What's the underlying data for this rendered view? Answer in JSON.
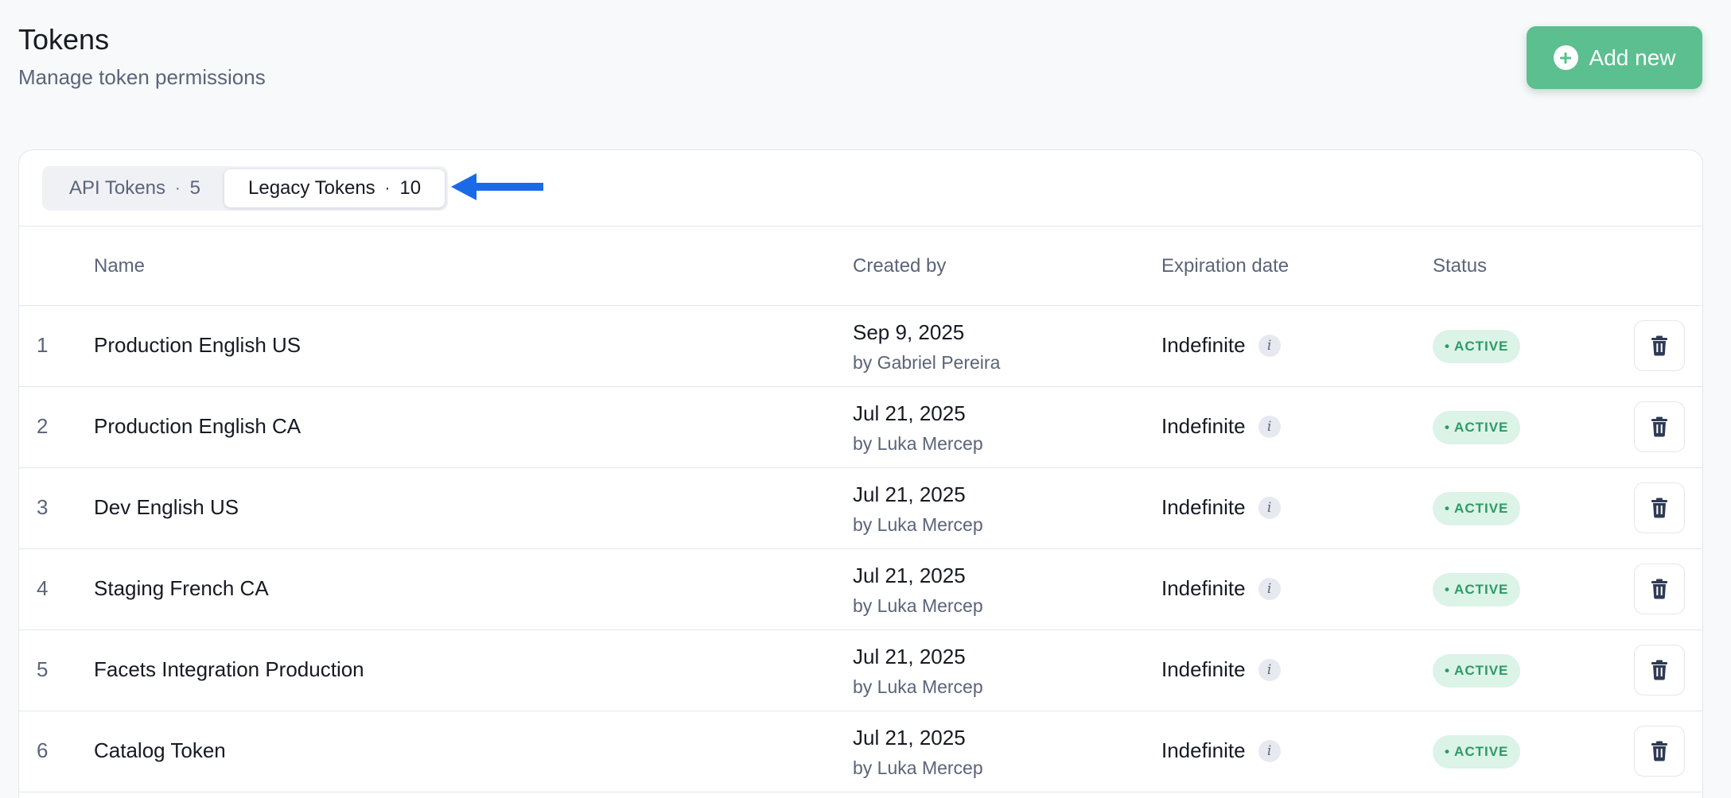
{
  "header": {
    "title": "Tokens",
    "subtitle": "Manage token permissions",
    "add_label": "Add new"
  },
  "tabs": [
    {
      "label": "API Tokens",
      "separator": "·",
      "count": "5",
      "active": false
    },
    {
      "label": "Legacy Tokens",
      "separator": "·",
      "count": "10",
      "active": true
    }
  ],
  "table": {
    "columns": {
      "name": "Name",
      "created_by": "Created by",
      "expiration": "Expiration date",
      "status": "Status"
    },
    "rows": [
      {
        "index": "1",
        "name": "Production English US",
        "date": "Sep 9, 2025",
        "by": "by Gabriel Pereira",
        "expiration": "Indefinite",
        "status": "• ACTIVE"
      },
      {
        "index": "2",
        "name": "Production English CA",
        "date": "Jul 21, 2025",
        "by": "by Luka Mercep",
        "expiration": "Indefinite",
        "status": "• ACTIVE"
      },
      {
        "index": "3",
        "name": "Dev English US",
        "date": "Jul 21, 2025",
        "by": "by Luka Mercep",
        "expiration": "Indefinite",
        "status": "• ACTIVE"
      },
      {
        "index": "4",
        "name": "Staging French CA",
        "date": "Jul 21, 2025",
        "by": "by Luka Mercep",
        "expiration": "Indefinite",
        "status": "• ACTIVE"
      },
      {
        "index": "5",
        "name": "Facets Integration Production",
        "date": "Jul 21, 2025",
        "by": "by Luka Mercep",
        "expiration": "Indefinite",
        "status": "• ACTIVE"
      },
      {
        "index": "6",
        "name": "Catalog Token",
        "date": "Jul 21, 2025",
        "by": "by Luka Mercep",
        "expiration": "Indefinite",
        "status": "• ACTIVE"
      }
    ]
  },
  "icons": {
    "add": "plus-circle-icon",
    "info": "info-icon",
    "delete": "trash-icon",
    "annotation": "arrow-left-icon"
  },
  "colors": {
    "accent_green": "#5bbf8f",
    "status_green": "#2c9a66",
    "status_bg": "#dcf3e7",
    "annotation_blue": "#1a6ae8"
  }
}
